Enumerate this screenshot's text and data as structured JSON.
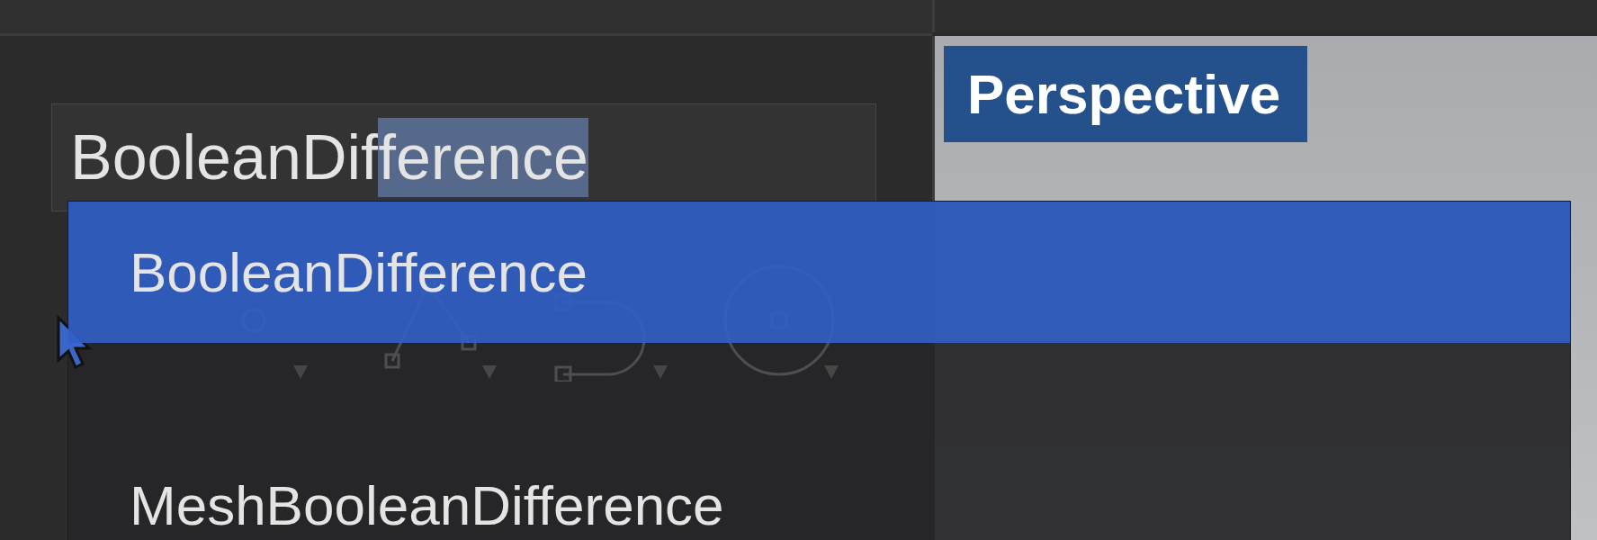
{
  "command_field": {
    "value": "BooleanDif",
    "selected_text": "ference"
  },
  "viewport": {
    "label": "Perspective"
  },
  "autocomplete": {
    "items": [
      {
        "label": "BooleanDifference",
        "selected": true
      },
      {
        "label": "MeshBooleanDifference",
        "selected": false
      }
    ]
  }
}
